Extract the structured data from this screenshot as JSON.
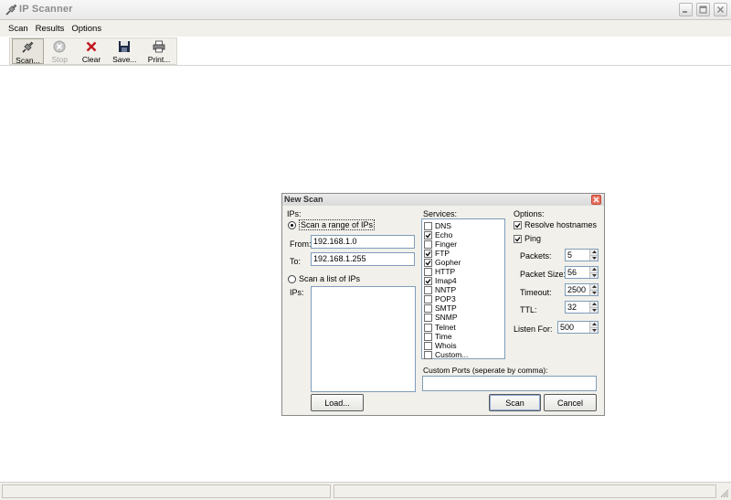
{
  "window": {
    "title": "IP Scanner"
  },
  "menu": [
    {
      "label": "Scan"
    },
    {
      "label": "Results"
    },
    {
      "label": "Options"
    }
  ],
  "toolbar": [
    {
      "label": "Scan...",
      "icon": "plug-icon",
      "state": "pressed"
    },
    {
      "label": "Stop",
      "icon": "stop-icon",
      "state": "disabled"
    },
    {
      "label": "Clear",
      "icon": "x-icon",
      "state": "normal"
    },
    {
      "label": "Save...",
      "icon": "floppy-disk-icon",
      "state": "normal"
    },
    {
      "label": "Print...",
      "icon": "printer-icon",
      "state": "normal"
    }
  ],
  "dialog": {
    "title": "New Scan",
    "ips": {
      "group_label": "IPs:",
      "range_radio_label": "Scan a range of IPs",
      "range_selected": true,
      "from_label": "From:",
      "from_value": "192.168.1.0",
      "to_label": "To:",
      "to_value": "192.168.1.255",
      "list_radio_label": "Scan a list of IPs",
      "list_label": "IPs:",
      "load_button": "Load..."
    },
    "services": {
      "label": "Services:",
      "items": [
        {
          "name": "DNS",
          "checked": false
        },
        {
          "name": "Echo",
          "checked": true
        },
        {
          "name": "Finger",
          "checked": false
        },
        {
          "name": "FTP",
          "checked": true
        },
        {
          "name": "Gopher",
          "checked": true
        },
        {
          "name": "HTTP",
          "checked": false
        },
        {
          "name": "Imap4",
          "checked": true
        },
        {
          "name": "NNTP",
          "checked": false
        },
        {
          "name": "POP3",
          "checked": false
        },
        {
          "name": "SMTP",
          "checked": false
        },
        {
          "name": "SNMP",
          "checked": false
        },
        {
          "name": "Telnet",
          "checked": false
        },
        {
          "name": "Time",
          "checked": false
        },
        {
          "name": "Whois",
          "checked": false
        },
        {
          "name": "Custom...",
          "checked": false
        }
      ],
      "custom_ports_label": "Custom Ports (seperate by comma):",
      "custom_ports_value": ""
    },
    "options": {
      "label": "Options:",
      "resolve_hostnames": {
        "label": "Resolve hostnames",
        "checked": true
      },
      "ping": {
        "label": "Ping",
        "checked": true
      },
      "packets": {
        "label": "Packets:",
        "value": "5"
      },
      "packet_size": {
        "label": "Packet Size:",
        "value": "56"
      },
      "timeout": {
        "label": "Timeout:",
        "value": "2500"
      },
      "ttl": {
        "label": "TTL:",
        "value": "32"
      },
      "listen_for": {
        "label": "Listen For:",
        "value": "500"
      }
    },
    "buttons": {
      "scan": "Scan",
      "cancel": "Cancel"
    }
  }
}
